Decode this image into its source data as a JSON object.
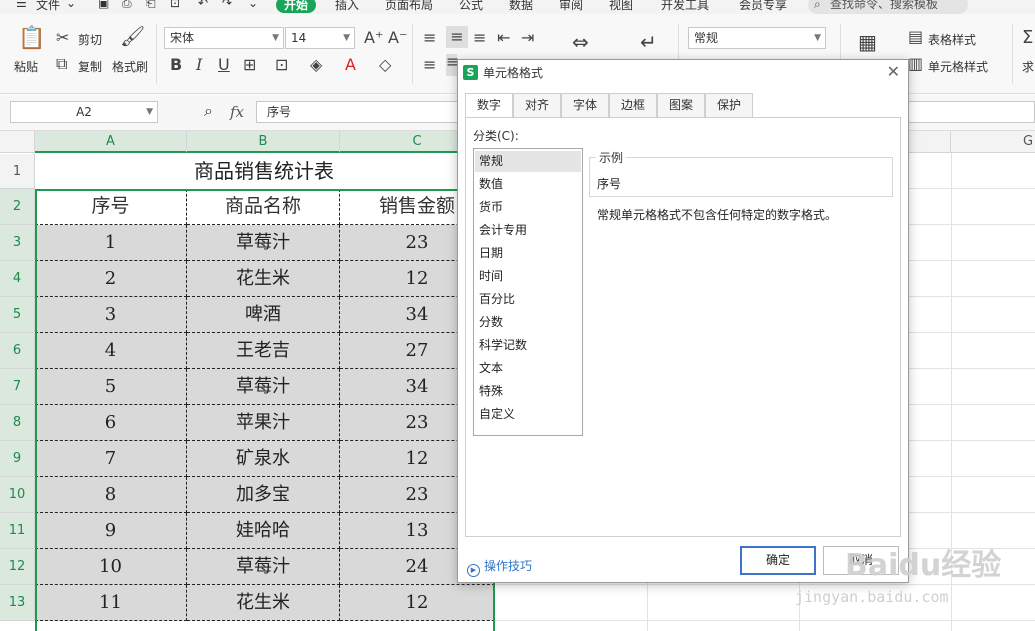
{
  "menu": {
    "items": [
      "文件",
      "开始",
      "插入",
      "页面布局",
      "公式",
      "数据",
      "审阅",
      "视图",
      "开发工具",
      "会员专享"
    ],
    "search_placeholder": "查找命令、搜索模板"
  },
  "ribbon": {
    "paste": "粘贴",
    "cut": "剪切",
    "copy": "复制",
    "format_painter": "格式刷",
    "font_name": "宋体",
    "font_size": "14",
    "number_format": "常规",
    "table_style": "表格样式",
    "cell_style": "单元格样式",
    "sum": "求"
  },
  "formula_bar": {
    "name_box": "A2",
    "fx": "fx",
    "content": "序号"
  },
  "sheet": {
    "columns": [
      "A",
      "B",
      "C",
      "G"
    ],
    "row_numbers": [
      "1",
      "2",
      "3",
      "4",
      "5",
      "6",
      "7",
      "8",
      "9",
      "10",
      "11",
      "12",
      "13"
    ],
    "title": "商品销售统计表",
    "headers": [
      "序号",
      "商品名称",
      "销售金额"
    ],
    "rows": [
      [
        "1",
        "草莓汁",
        "23"
      ],
      [
        "2",
        "花生米",
        "12"
      ],
      [
        "3",
        "啤酒",
        "34"
      ],
      [
        "4",
        "王老吉",
        "27"
      ],
      [
        "5",
        "草莓汁",
        "34"
      ],
      [
        "6",
        "苹果汁",
        "23"
      ],
      [
        "7",
        "矿泉水",
        "12"
      ],
      [
        "8",
        "加多宝",
        "23"
      ],
      [
        "9",
        "娃哈哈",
        "13"
      ],
      [
        "10",
        "草莓汁",
        "24"
      ],
      [
        "11",
        "花生米",
        "12"
      ]
    ]
  },
  "dialog": {
    "title": "单元格格式",
    "tabs": [
      "数字",
      "对齐",
      "字体",
      "边框",
      "图案",
      "保护"
    ],
    "category_label": "分类(C):",
    "categories": [
      "常规",
      "数值",
      "货币",
      "会计专用",
      "日期",
      "时间",
      "百分比",
      "分数",
      "科学记数",
      "文本",
      "特殊",
      "自定义"
    ],
    "selected_category": "常规",
    "example_label": "示例",
    "example_value": "序号",
    "description": "常规单元格格式不包含任何特定的数字格式。",
    "tips": "操作技巧",
    "ok": "确定",
    "cancel": "取消"
  },
  "watermark": {
    "main": "Baidu经验",
    "sub": "jingyan.baidu.com"
  },
  "colors": {
    "accent": "#1aa45a",
    "selection": "#1d9a50",
    "shade": "#d9d9d9"
  }
}
